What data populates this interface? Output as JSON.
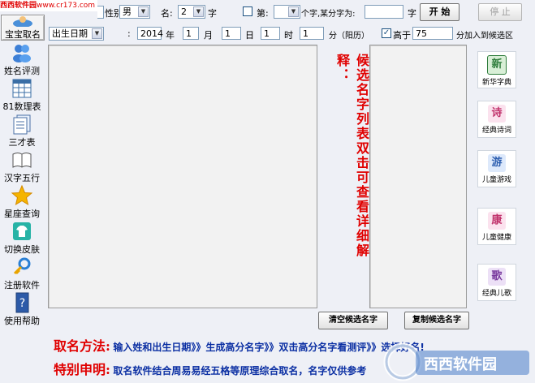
{
  "watermark_top": "西西软件园",
  "watermark_url": "www.cr173.com",
  "form": {
    "surname_label": "姓",
    "gender_label": "性别",
    "gender_value": "男",
    "name_label": "名:",
    "name_len_value": "2",
    "char_label": "字",
    "fix_label": "第:",
    "fix_pos_value": "",
    "fix_text_label": "个字,某分字为:",
    "fix_char_value": "",
    "fix_char_suffix": "字",
    "start_button": "开 始",
    "stop_button": "停 止",
    "birth_select": "出生日期",
    "colon": ":",
    "year_value": "2014",
    "year_label": "年",
    "month_value": "1",
    "month_label": "月",
    "day_value": "1",
    "day_label": "日",
    "hour_value": "1",
    "hour_label": "时",
    "minute_value": "1",
    "minute_label": "分（阳历）",
    "above_checked": true,
    "above_label": "高于",
    "score_value": "75",
    "score_suffix": "分加入到候选区"
  },
  "sidebar": [
    {
      "label": "宝宝取名",
      "icon": "baby-icon",
      "active": true
    },
    {
      "label": "姓名评测",
      "icon": "people-icon"
    },
    {
      "label": "81数理表",
      "icon": "table-grid-icon"
    },
    {
      "label": "三才表",
      "icon": "documents-icon"
    },
    {
      "label": "汉字五行",
      "icon": "book-icon"
    },
    {
      "label": "星座查询",
      "icon": "star-icon"
    },
    {
      "label": "切换皮肤",
      "icon": "shirt-icon"
    },
    {
      "label": "注册软件",
      "icon": "key-icon"
    },
    {
      "label": "使用帮助",
      "icon": "help-book-icon"
    }
  ],
  "hint_vertical": "候选名字列表双击可查看详细解释：",
  "buttons": {
    "clear_candidates": "清空候选名字",
    "copy_candidates": "复制候选名字"
  },
  "right_tools": [
    {
      "glyph": "新",
      "label": "新华字典",
      "icon": "dictionary-icon",
      "color": "#2f7d3c"
    },
    {
      "glyph": "诗",
      "label": "经典诗词",
      "icon": "poetry-icon",
      "color": "#c0306a"
    },
    {
      "glyph": "游",
      "label": "儿童游戏",
      "icon": "game-icon",
      "color": "#2d5fb0"
    },
    {
      "glyph": "康",
      "label": "儿童健康",
      "icon": "health-icon",
      "color": "#c0306a"
    },
    {
      "glyph": "歌",
      "label": "经典儿歌",
      "icon": "song-icon",
      "color": "#7a3b9e"
    }
  ],
  "footer": {
    "method_label": "取名方法:",
    "method_text": "输入姓和出生日期》》生成高分名字》》双击高分名字看测评》》选择好名!",
    "notice_label": "特别申明:",
    "notice_text": "取名软件结合周易易经五格等原理综合取名，名字仅供参考",
    "logo_text": "西西软件园"
  },
  "colors": {
    "accent_red": "#e00000",
    "footer_blue": "#0b2fa3",
    "background": "#eef0f6"
  }
}
